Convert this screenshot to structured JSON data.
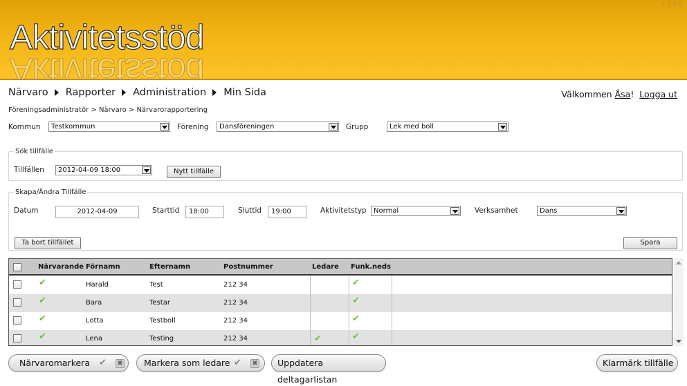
{
  "app": {
    "version": "1.7.0.0",
    "logo_text": "Aktivitetsstöd"
  },
  "nav": {
    "items": [
      {
        "label": "Närvaro"
      },
      {
        "label": "Rapporter"
      },
      {
        "label": "Administration"
      },
      {
        "label": "Min Sida"
      }
    ]
  },
  "user": {
    "welcome_prefix": "Välkommen ",
    "name": "Åsa",
    "suffix": "!",
    "logout_label": "Logga ut"
  },
  "breadcrumb": "Föreningsadministratör > Närvaro > Närvarorapportering",
  "filters": {
    "kommun_label": "Kommun",
    "kommun_value": "Testkommun",
    "forening_label": "Förening",
    "forening_value": "Dansföreningen",
    "grupp_label": "Grupp",
    "grupp_value": "Lek med boll"
  },
  "search_panel": {
    "legend": "Sök tillfälle",
    "tillfallen_label": "Tillfällen",
    "tillfallen_value": "2012-04-09 18:00",
    "new_button": "Nytt tillfälle"
  },
  "edit_panel": {
    "legend": "Skapa/Ändra Tillfälle",
    "datum_label": "Datum",
    "datum_value": "2012-04-09",
    "starttid_label": "Starttid",
    "starttid_value": "18:00",
    "sluttid_label": "Sluttid",
    "sluttid_value": "19:00",
    "aktivitetstyp_label": "Aktivitetstyp",
    "aktivitetstyp_value": "Normal",
    "verksamhet_label": "Verksamhet",
    "verksamhet_value": "Dans",
    "delete_button": "Ta bort tillfället",
    "save_button": "Spara"
  },
  "grid": {
    "columns": [
      "Närvarande",
      "Förnamn",
      "Efternamn",
      "Postnummer",
      "Ledare",
      "Funk.neds"
    ],
    "rows": [
      {
        "narvarande": true,
        "fornamn": "Harald",
        "efternamn": "Test",
        "postnummer": "212 34",
        "ledare": false,
        "funkneds": true
      },
      {
        "narvarande": true,
        "fornamn": "Bara",
        "efternamn": "Testar",
        "postnummer": "212 34",
        "ledare": false,
        "funkneds": true
      },
      {
        "narvarande": true,
        "fornamn": "Lotta",
        "efternamn": "Testboll",
        "postnummer": "212 34",
        "ledare": false,
        "funkneds": true
      },
      {
        "narvarande": true,
        "fornamn": "Lena",
        "efternamn": "Testing",
        "postnummer": "212 34",
        "ledare": true,
        "funkneds": true
      }
    ]
  },
  "actions": {
    "narvaromarkera": "Närvaromarkera",
    "markera_ledare": "Markera som ledare",
    "uppdatera": "Uppdatera deltagarlistan",
    "klarmark": "Klarmärk tillfälle"
  },
  "icons": {
    "check": "✔",
    "cross": "✖"
  },
  "colors": {
    "header_top": "#dfa106",
    "header_bottom": "#fcc227",
    "check_green": "#6cc23a",
    "grid_header": "#c8c8c8",
    "row_alt": "#e2e2e2"
  }
}
